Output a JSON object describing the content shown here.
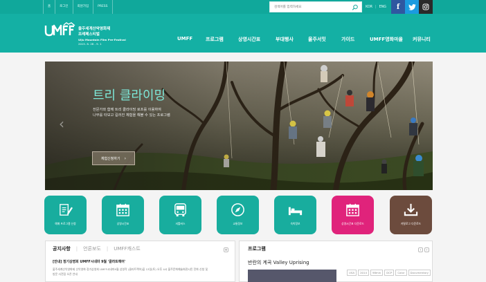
{
  "util_links": [
    "홈",
    "로그인",
    "회원가입",
    "PRESS"
  ],
  "search": {
    "placeholder": "검색어를 입력하세요"
  },
  "lang": {
    "ko": "KOR",
    "en": "ENG"
  },
  "social": [
    {
      "name": "facebook",
      "glyph": "f",
      "color": "#2f57a0"
    },
    {
      "name": "twitter",
      "glyph": "t",
      "color": "#1b9be0"
    },
    {
      "name": "instagram",
      "glyph": "◎",
      "color": "#2a2a2a"
    }
  ],
  "logo": {
    "mark": "UMFF",
    "title_ko_1": "울주세계산악영화제",
    "title_ko_2": "프레페스티벌",
    "title_en": "Ulju Mountain Film Pre-Festival",
    "date": "2015. 8. 28 - 9. 1"
  },
  "nav": [
    "UMFF",
    "프로그램",
    "상영시간표",
    "부대행사",
    "울주서밋",
    "가이드",
    "UMFF영화마을",
    "커뮤니티"
  ],
  "banner": {
    "title": "트리 클라이밍",
    "desc_1": "전문가와 함께 트리 클라이밍 로프를 이용하여",
    "desc_2": "나무를 타보고 길러진 체험을 해볼 수 있는 프로그램",
    "button": "체험신청하기",
    "button_icon": "chevron-right-icon"
  },
  "quick_links": [
    {
      "label": "예매 프로그램 신청",
      "icon": "document-pen-icon",
      "color": "#18ad9e"
    },
    {
      "label": "상영시간표",
      "icon": "calendar-icon",
      "color": "#18ad9e"
    },
    {
      "label": "셔틀버스",
      "icon": "bus-icon",
      "color": "#18ad9e"
    },
    {
      "label": "교통정보",
      "icon": "compass-icon",
      "color": "#18ad9e"
    },
    {
      "label": "숙박정보",
      "icon": "bed-icon",
      "color": "#18ad9e"
    },
    {
      "label": "상영시간표 다운로드",
      "icon": "calendar-icon",
      "color": "#e0237b"
    },
    {
      "label": "카탈로그 다운로드",
      "icon": "download-icon",
      "color": "#6c4b3d"
    }
  ],
  "notice": {
    "tabs": [
      "공지사항",
      "언론보도",
      "UMFF캐스트"
    ],
    "title": "[안내] 정기상영회 UMFF시네마 9월 '클라트랙어'",
    "body_1": "울주세계산악영화제 산악영화 정기상영회 UMFF시네마9월 상영작 (클라트랙어)을 13일(토) 오후 4시 울주문화예술회관시민 전화 신청 및",
    "body_2": "방문 사전접 오픈 안내"
  },
  "program": {
    "heading": "프로그램",
    "title": "반란의 계곡 Valley Uprising",
    "tags": [
      "USA",
      "2014",
      "98min",
      "DCP",
      "Color",
      "Documentary"
    ]
  }
}
